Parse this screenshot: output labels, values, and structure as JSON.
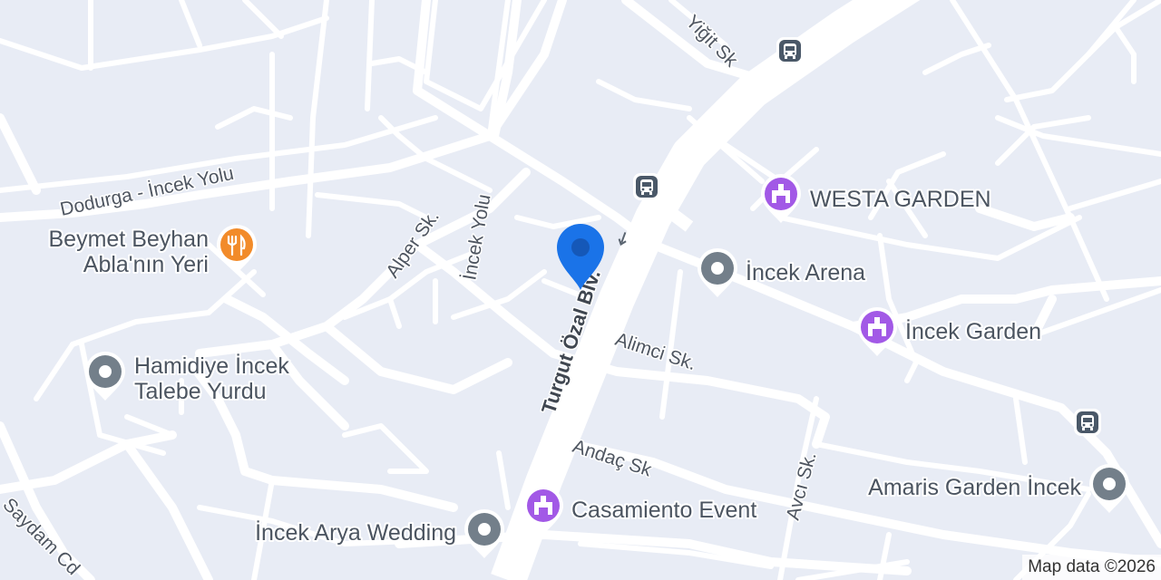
{
  "streets": {
    "dodurga": "Dodurga - İncek Yolu",
    "alper": "Alper Sk.",
    "incek_yolu": "İncek Yolu",
    "turgut": "Turgut Özal Blv.",
    "alimci": "Alimci Sk.",
    "andac": "Andaç Sk",
    "avci": "Avcı Sk.",
    "yigit": "Yiğit Sk",
    "saydam": "Saydam Cd"
  },
  "pois": {
    "beymet_line1": "Beymet Beyhan",
    "beymet_line2": "Abla'nın Yeri",
    "hamidiye_line1": "Hamidiye İncek",
    "hamidiye_line2": "Talebe Yurdu",
    "westa": "WESTA GARDEN",
    "incek_arena": "İncek Arena",
    "incek_garden": "İncek Garden",
    "amaris": "Amaris Garden İncek",
    "casamiento": "Casamiento Event",
    "arya": "İncek Arya Wedding"
  },
  "icons": {
    "restaurant": "fork-knife-icon",
    "event_venue": "event-venue-icon",
    "generic_place": "place-dot-icon",
    "bus": "bus-stop-icon",
    "location": "location-pin-icon"
  },
  "colors": {
    "map_bg": "#e8ecf5",
    "road": "#ffffff",
    "restaurant_pin": "#f28b2a",
    "venue_pin": "#a259e6",
    "generic_pin": "#737f8a",
    "location_pin": "#1a73e8"
  },
  "attribution": "Map data ©2026"
}
